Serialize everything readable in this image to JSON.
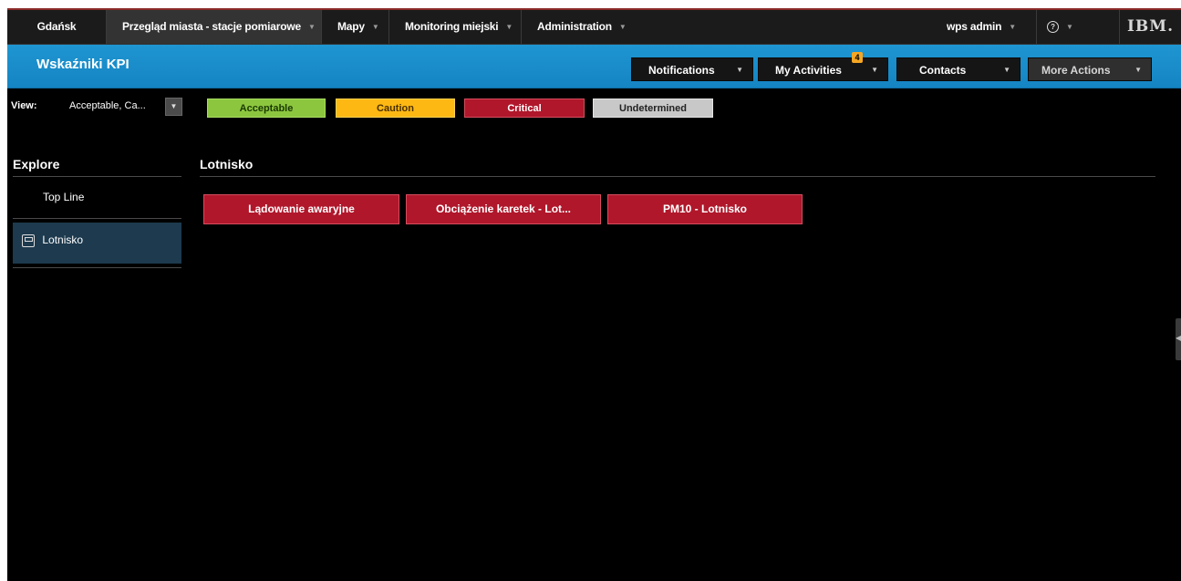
{
  "topnav": {
    "city": "Gdańsk",
    "items": [
      {
        "label": "Przegląd miasta - stacje pomiarowe"
      },
      {
        "label": "Mapy"
      },
      {
        "label": "Monitoring miejski"
      },
      {
        "label": "Administration"
      }
    ],
    "user": "wps admin",
    "logo": "IBM."
  },
  "banner": {
    "title": "Wskaźniki KPI",
    "buttons": [
      {
        "label": "Notifications"
      },
      {
        "label": "My Activities",
        "badge": "4"
      },
      {
        "label": "Contacts"
      },
      {
        "label": "More Actions"
      }
    ]
  },
  "filter": {
    "view_label": "View:",
    "view_value": "Acceptable, Ca...",
    "chips": [
      {
        "label": "Acceptable",
        "color": "#8cc63f"
      },
      {
        "label": "Caution",
        "color": "#fdb813"
      },
      {
        "label": "Critical",
        "color": "#b0172b"
      },
      {
        "label": "Undetermined",
        "color": "#c8c8c8"
      }
    ]
  },
  "sidebar": {
    "heading": "Explore",
    "items": [
      {
        "label": "Top Line"
      },
      {
        "label": "Lotnisko",
        "icon": "station-icon"
      }
    ]
  },
  "main": {
    "heading": "Lotnisko",
    "kpis": [
      {
        "label": "Lądowanie awaryjne",
        "status": "Critical"
      },
      {
        "label": "Obciążenie karetek - Lot...",
        "status": "Critical"
      },
      {
        "label": "PM10 - Lotnisko",
        "status": "Critical"
      }
    ]
  }
}
